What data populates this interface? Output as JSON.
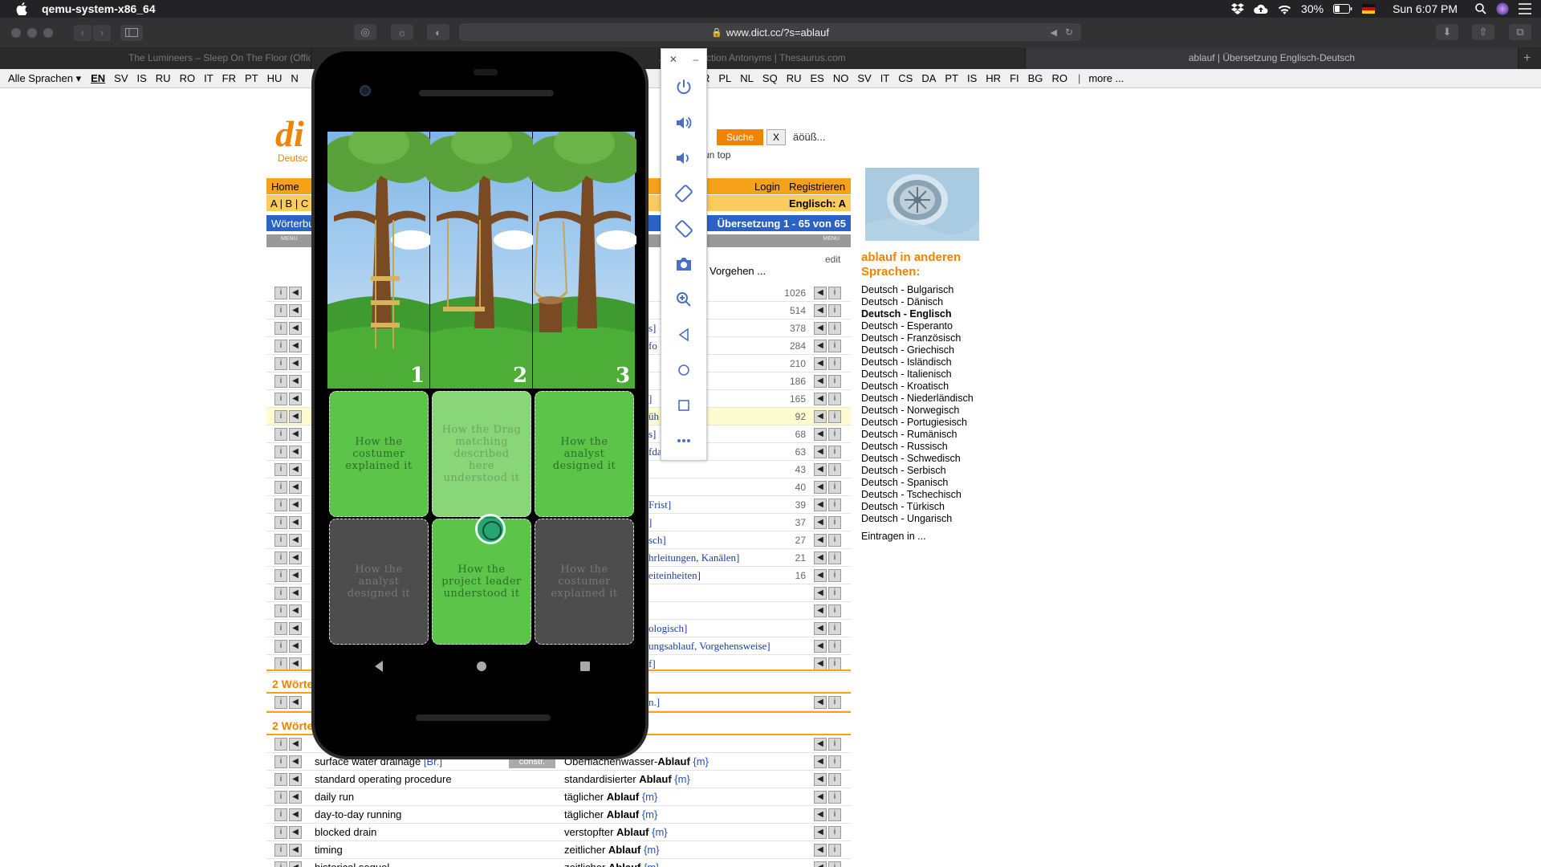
{
  "menubar": {
    "app_name": "qemu-system-x86_64",
    "battery": "30%",
    "clock": "Sun 6:07 PM"
  },
  "browser": {
    "url": "www.dict.cc/?s=ablauf",
    "tabs": [
      "The Lumineers – Sleep On The Floor (Official...",
      "...nyms, Section Antonyms | Thesaurus.com",
      "ablauf | Übersetzung Englisch-Deutsch"
    ]
  },
  "page": {
    "langbar": {
      "alle": "Alle Sprachen",
      "langs_left": [
        "EN",
        "SV",
        "IS",
        "RU",
        "RO",
        "IT",
        "FR",
        "PT",
        "HU",
        "N"
      ],
      "langs_right": [
        "R",
        "PL",
        "NL",
        "SQ",
        "RU",
        "ES",
        "NO",
        "SV",
        "IT",
        "CS",
        "DA",
        "PT",
        "IS",
        "HR",
        "FI",
        "BG",
        "RO"
      ],
      "more": "more ..."
    },
    "logo": "di",
    "logo_sub": "Deutsc",
    "search_button": "Suche",
    "clear_button": "X",
    "umlaut_button": "äöüß...",
    "desktop_label": "un    top",
    "nav": {
      "home": "Home",
      "login": "Login",
      "register": "Registrieren",
      "alpha_prefix": "A | B | C",
      "alpha_right": "Englisch: A",
      "woerterbuch": "Wörterbu",
      "uebersetzung": "Übersetzung 1 - 65 von 65",
      "edit": "edit",
      "vorgehen": "Vorgehen ...",
      "menu_left": "MENU",
      "menu_right": "MENU"
    },
    "rows": [
      {
        "bracket": "",
        "count": "1026"
      },
      {
        "bracket": "",
        "count": "514"
      },
      {
        "bracket": "s]",
        "count": "378"
      },
      {
        "bracket": "fo",
        "count": "284"
      },
      {
        "bracket": "",
        "count": "210"
      },
      {
        "bracket": "",
        "count": "186"
      },
      {
        "bracket": "]",
        "count": "165"
      },
      {
        "bracket": "üh",
        "count": "92"
      },
      {
        "bracket": "s]",
        "count": "68"
      },
      {
        "bracket": "fda    der Frist]",
        "count": "63"
      },
      {
        "bracket": "",
        "count": "43"
      },
      {
        "bracket": "",
        "count": "40"
      },
      {
        "bracket": "Frist]",
        "count": "39"
      },
      {
        "bracket": "]",
        "count": "37"
      },
      {
        "bracket": "sch]",
        "count": "27"
      },
      {
        "bracket": "hrleitungen, Kanälen]",
        "count": "21"
      },
      {
        "bracket": "eiteinheiten]",
        "count": "16"
      },
      {
        "bracket": "",
        "count": ""
      },
      {
        "bracket": "",
        "count": ""
      },
      {
        "bracket": "ologisch]",
        "count": ""
      },
      {
        "bracket": "ungsablauf, Vorgehensweise]",
        "count": ""
      },
      {
        "bracket": "f]",
        "count": ""
      }
    ],
    "section1": "2 Wörte",
    "section1_row": "n.]",
    "section2": "2 Wörte",
    "entries": [
      {
        "en": "",
        "de_pre": "",
        "de_bold": "ser-Ablauf",
        "gen": "{m}"
      },
      {
        "en": "surface water drainage",
        "br": "[Br.]",
        "constr": "constr.",
        "de_pre": "Oberflächenwasser-",
        "de_bold": "Ablauf",
        "gen": "{m}"
      },
      {
        "en": "standard operating procedure",
        "de_pre": "standardisierter ",
        "de_bold": "Ablauf",
        "gen": "{m}"
      },
      {
        "en": "daily run",
        "de_pre": "täglicher ",
        "de_bold": "Ablauf",
        "gen": "{m}"
      },
      {
        "en": "day-to-day running",
        "de_pre": "täglicher ",
        "de_bold": "Ablauf",
        "gen": "{m}"
      },
      {
        "en": "blocked drain",
        "de_pre": "verstopfter ",
        "de_bold": "Ablauf",
        "gen": "{m}"
      },
      {
        "en": "timing",
        "de_pre": "zeitlicher ",
        "de_bold": "Ablauf",
        "gen": "{m}"
      },
      {
        "en": "historical sequel",
        "de_pre": "zeitlicher ",
        "de_bold": "Ablauf",
        "gen": "{m}"
      }
    ],
    "sidebar": {
      "title": "ablauf in anderen Sprachen:",
      "languages": [
        "Deutsch - Bulgarisch",
        "Deutsch - Dänisch",
        "Deutsch - Englisch",
        "Deutsch - Esperanto",
        "Deutsch - Französisch",
        "Deutsch - Griechisch",
        "Deutsch - Isländisch",
        "Deutsch - Italienisch",
        "Deutsch - Kroatisch",
        "Deutsch - Niederländisch",
        "Deutsch - Norwegisch",
        "Deutsch - Portugiesisch",
        "Deutsch - Rumänisch",
        "Deutsch - Russisch",
        "Deutsch - Schwedisch",
        "Deutsch - Serbisch",
        "Deutsch - Spanisch",
        "Deutsch - Tschechisch",
        "Deutsch - Türkisch",
        "Deutsch - Ungarisch"
      ],
      "selected": "Deutsch - Englisch",
      "eintragen": "Eintragen in ..."
    }
  },
  "emulator": {
    "panel_buttons": [
      "power-icon",
      "volume-up-icon",
      "volume-down-icon",
      "rotate-left-icon",
      "rotate-right-icon",
      "camera-icon",
      "zoom-icon",
      "back-icon",
      "home-icon",
      "overview-icon",
      "more-icon"
    ],
    "panels": [
      "1",
      "2",
      "3"
    ],
    "tiles": [
      {
        "text": "How the costumer explained it",
        "style": "green"
      },
      {
        "text": "How the Drag matching described here understood it",
        "style": "light"
      },
      {
        "text": "How the analyst designed it",
        "style": "green"
      },
      {
        "text": "How the analyst designed it",
        "style": "dark"
      },
      {
        "text": "How the project leader understood it",
        "style": "green"
      },
      {
        "text": "How the costumer explained it",
        "style": "dark"
      }
    ]
  }
}
